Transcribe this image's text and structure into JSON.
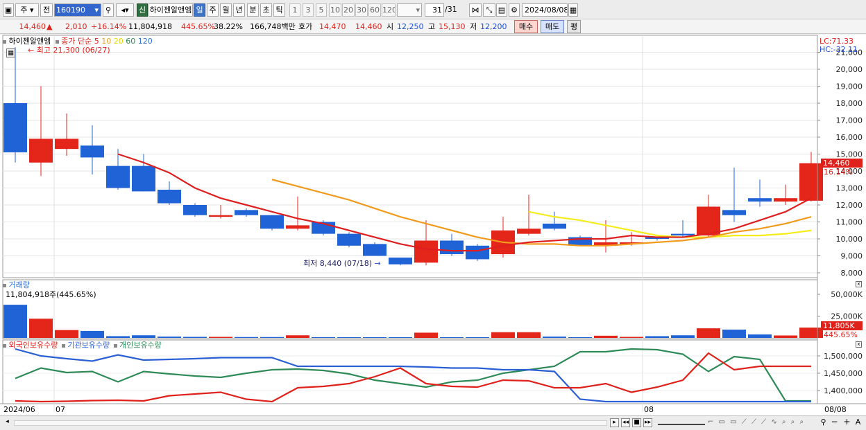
{
  "toolbar": {
    "period": "주",
    "prev": "전",
    "code": "160190",
    "new_badge": "신",
    "stock_name": "하이젠알앤엠",
    "intervals": [
      "일",
      "주",
      "월",
      "년",
      "분",
      "초",
      "틱"
    ],
    "active_interval": "일",
    "numbers": [
      "1",
      "3",
      "5",
      "10",
      "20",
      "30",
      "60",
      "120"
    ],
    "count": "31",
    "count_total": "/31",
    "date": "2024/08/08"
  },
  "quote": {
    "price": "14,460",
    "arrow": "▲",
    "change": "2,010",
    "change_pct": "+16.14%",
    "volume": "11,804,918",
    "volume_ratio": "445.65%",
    "turnover": "38.22%",
    "amount": "166,748백만",
    "bid_label": "호가",
    "ask": "14,470",
    "bid": "14,460",
    "open_label": "시",
    "open": "12,250",
    "high_label": "고",
    "high": "15,130",
    "low_label": "저",
    "low": "12,200",
    "buy_button": "매수",
    "sell_button": "매도",
    "avg_button": "평"
  },
  "price_panel": {
    "stock_label": "하이젠알앤엠",
    "legend_title": "종가 단순",
    "ma_periods": [
      "5",
      "10",
      "20",
      "60",
      "120"
    ],
    "ma_colors": [
      "#e0201a",
      "#f0a020",
      "#f2e800",
      "#2e8b57",
      "#2a6fd6"
    ],
    "highest_note": "최고 21,300 (06/27)",
    "lowest_note": "최저 8,440 (07/18)",
    "lc": "LC:71.33",
    "hc": "HC:-32.11",
    "last_price": "14,460",
    "last_pct": "16.14%",
    "y_ticks": [
      "21,000",
      "20,000",
      "19,000",
      "18,000",
      "17,000",
      "16,000",
      "15,000",
      "14,000",
      "13,000",
      "12,000",
      "11,000",
      "10,000",
      "9,000",
      "8,000"
    ]
  },
  "volume_panel": {
    "title": "거래량",
    "current": "11,804,918주(445.65%)",
    "y_ticks": [
      "50,000K",
      "25,000K"
    ],
    "last": "11,805K",
    "last_pct": "445.65%"
  },
  "holdings_panel": {
    "legend": [
      "외국인보유수량",
      "기관보유수량",
      "개인보유수량"
    ],
    "colors": [
      "#e0201a",
      "#2a5fd6",
      "#2e8b57"
    ],
    "y_ticks": [
      "1,500,000",
      "1,450,000",
      "1,400,000"
    ]
  },
  "x_axis": {
    "labels": [
      "2024/06",
      "07",
      "08"
    ],
    "right_date": "08/08"
  },
  "chart_data": {
    "type": "candlestick",
    "candles": [
      {
        "o": 18000,
        "h": 21300,
        "l": 14500,
        "c": 15100
      },
      {
        "o": 14500,
        "h": 19000,
        "l": 13700,
        "c": 15900
      },
      {
        "o": 15300,
        "h": 17400,
        "l": 14900,
        "c": 15900
      },
      {
        "o": 15500,
        "h": 16700,
        "l": 13800,
        "c": 14800
      },
      {
        "o": 14300,
        "h": 15300,
        "l": 12900,
        "c": 13000
      },
      {
        "o": 14300,
        "h": 15000,
        "l": 12800,
        "c": 12800
      },
      {
        "o": 12900,
        "h": 13400,
        "l": 12000,
        "c": 12100
      },
      {
        "o": 12000,
        "h": 12100,
        "l": 11300,
        "c": 11400
      },
      {
        "o": 11300,
        "h": 12000,
        "l": 11200,
        "c": 11400
      },
      {
        "o": 11700,
        "h": 11800,
        "l": 11300,
        "c": 11400
      },
      {
        "o": 11400,
        "h": 11400,
        "l": 10500,
        "c": 10600
      },
      {
        "o": 10600,
        "h": 12500,
        "l": 10500,
        "c": 10800
      },
      {
        "o": 11000,
        "h": 11100,
        "l": 10200,
        "c": 10300
      },
      {
        "o": 10300,
        "h": 10400,
        "l": 9500,
        "c": 9600
      },
      {
        "o": 9700,
        "h": 9800,
        "l": 9000,
        "c": 9000
      },
      {
        "o": 8900,
        "h": 8900,
        "l": 8440,
        "c": 8500
      },
      {
        "o": 8600,
        "h": 11100,
        "l": 8440,
        "c": 9900
      },
      {
        "o": 9900,
        "h": 10300,
        "l": 9000,
        "c": 9100
      },
      {
        "o": 9600,
        "h": 9700,
        "l": 8700,
        "c": 8800
      },
      {
        "o": 9100,
        "h": 11300,
        "l": 8900,
        "c": 10500
      },
      {
        "o": 10300,
        "h": 12600,
        "l": 10200,
        "c": 10600
      },
      {
        "o": 10900,
        "h": 11600,
        "l": 10500,
        "c": 10600
      },
      {
        "o": 10100,
        "h": 10200,
        "l": 9600,
        "c": 9600
      },
      {
        "o": 9600,
        "h": 11100,
        "l": 9200,
        "c": 9800
      },
      {
        "o": 9700,
        "h": 10400,
        "l": 9600,
        "c": 9800
      },
      {
        "o": 10100,
        "h": 10100,
        "l": 9900,
        "c": 10000
      },
      {
        "o": 10300,
        "h": 11100,
        "l": 10100,
        "c": 10200
      },
      {
        "o": 10200,
        "h": 12600,
        "l": 10100,
        "c": 11900
      },
      {
        "o": 11700,
        "h": 14200,
        "l": 11000,
        "c": 11400
      },
      {
        "o": 12400,
        "h": 13500,
        "l": 11900,
        "c": 12200
      },
      {
        "o": 12200,
        "h": 13200,
        "l": 12000,
        "c": 12400
      },
      {
        "o": 12250,
        "h": 15130,
        "l": 12200,
        "c": 14460
      }
    ],
    "ma5": [
      null,
      null,
      null,
      null,
      15000,
      14500,
      13900,
      13000,
      12400,
      12000,
      11600,
      11200,
      10900,
      10500,
      10100,
      9700,
      9400,
      9300,
      9300,
      9600,
      9800,
      9900,
      10000,
      10000,
      10200,
      10100,
      10100,
      10300,
      10600,
      11100,
      11600,
      12400
    ],
    "ma10": [
      null,
      null,
      null,
      null,
      null,
      null,
      null,
      null,
      null,
      null,
      13500,
      13100,
      12700,
      12300,
      11800,
      11300,
      10900,
      10500,
      10100,
      9800,
      9700,
      9700,
      9600,
      9600,
      9700,
      9800,
      9900,
      10100,
      10400,
      10600,
      10900,
      11300
    ],
    "ma20": [
      null,
      null,
      null,
      null,
      null,
      null,
      null,
      null,
      null,
      null,
      null,
      null,
      null,
      null,
      null,
      null,
      null,
      null,
      null,
      null,
      11600,
      11300,
      11100,
      10800,
      10500,
      10200,
      10100,
      10100,
      10200,
      10200,
      10300,
      10500
    ],
    "volume_k": [
      38000,
      22000,
      9000,
      8000,
      2000,
      3000,
      1500,
      1200,
      1200,
      1000,
      1000,
      3000,
      900,
      800,
      600,
      400,
      6000,
      800,
      800,
      6500,
      6500,
      1500,
      600,
      2500,
      1200,
      2000,
      3000,
      11000,
      9500,
      4000,
      2800,
      11805
    ],
    "foreign": [
      1370000,
      1368000,
      1369000,
      1371000,
      1372000,
      1370000,
      1385000,
      1390000,
      1395000,
      1375000,
      1368000,
      1408000,
      1412000,
      1420000,
      1440000,
      1465000,
      1420000,
      1412000,
      1410000,
      1430000,
      1428000,
      1408000,
      1408000,
      1420000,
      1395000,
      1410000,
      1430000,
      1508000,
      1460000,
      1470000,
      1470000,
      1470000
    ],
    "institution": [
      1520000,
      1500000,
      1492000,
      1485000,
      1503000,
      1488000,
      1490000,
      1492000,
      1495000,
      1495000,
      1495000,
      1470000,
      1470000,
      1470000,
      1470000,
      1470000,
      1468000,
      1465000,
      1465000,
      1460000,
      1460000,
      1455000,
      1375000,
      1368000,
      1368000,
      1368000,
      1368000,
      1368000,
      1368000,
      1368000,
      1368000,
      1368000
    ],
    "individual": [
      1435000,
      1465000,
      1452000,
      1455000,
      1425000,
      1455000,
      1448000,
      1442000,
      1438000,
      1450000,
      1460000,
      1462000,
      1458000,
      1448000,
      1430000,
      1420000,
      1410000,
      1425000,
      1430000,
      1450000,
      1460000,
      1470000,
      1512000,
      1512000,
      1520000,
      1518000,
      1505000,
      1455000,
      1498000,
      1490000,
      1370000,
      1370000
    ]
  }
}
